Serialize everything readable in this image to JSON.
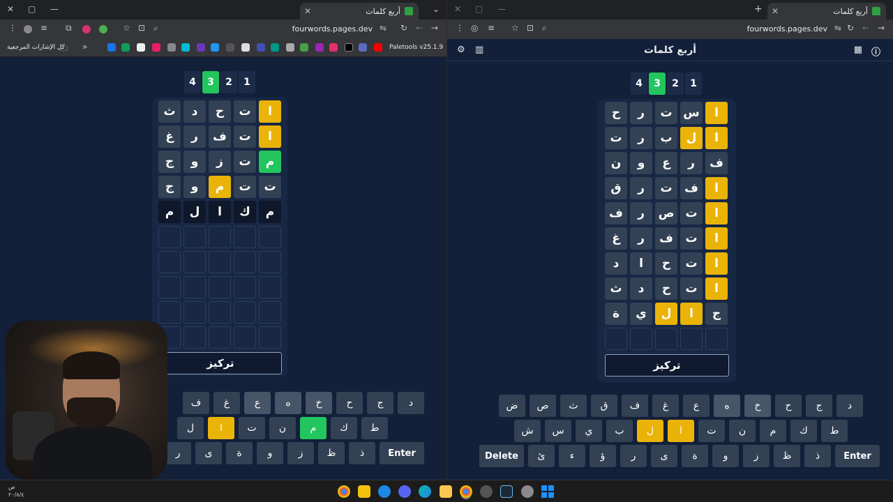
{
  "browser": {
    "tab_title": "أربع كلمات",
    "url": "fourwords.pages.dev",
    "bookmarks_label": "كل الإشارات المرجعية",
    "bookmark_ext": "Paletools v25.1.9",
    "minimize": "—",
    "maximize": "▢",
    "close": "✕",
    "new_tab": "+",
    "tab_close": "✕",
    "dropdown": "⌄",
    "bookmark_chev": "»"
  },
  "app": {
    "title": "أربع كلمات",
    "focus_label": "تركيز",
    "enter_label": "Enter",
    "delete_label": "Delete",
    "tabs": [
      "4",
      "3",
      "2",
      "1"
    ],
    "active_tab": "3"
  },
  "left_board": {
    "rows": [
      [
        "ا",
        "ت",
        "ح",
        "د",
        "ث"
      ],
      [
        "ا",
        "ت",
        "ف",
        "ر",
        "غ"
      ],
      [
        "م",
        "ت",
        "ز",
        "و",
        "ج"
      ],
      [
        "ت",
        "ت",
        "م",
        "و",
        "ج"
      ],
      [
        "م",
        "ك",
        "ا",
        "ل",
        "م"
      ]
    ]
  },
  "right_board": {
    "rows": [
      [
        "ا",
        "س",
        "ت",
        "ر",
        "ح"
      ],
      [
        "ا",
        "ل",
        "ب",
        "ر",
        "ت"
      ],
      [
        "ف",
        "ر",
        "ع",
        "و",
        "ن"
      ],
      [
        "ا",
        "ف",
        "ت",
        "ر",
        "ق"
      ],
      [
        "ا",
        "ت",
        "ص",
        "ر",
        "ف"
      ],
      [
        "ا",
        "ت",
        "ف",
        "ر",
        "غ"
      ],
      [
        "ا",
        "ت",
        "ح",
        "ا",
        "د"
      ],
      [
        "ا",
        "ت",
        "ح",
        "د",
        "ث"
      ],
      [
        "ج",
        "ا",
        "ل",
        "ي",
        "ة"
      ]
    ]
  },
  "keyboard": {
    "row1": [
      "د",
      "ج",
      "ح",
      "خ",
      "ه",
      "ع",
      "غ",
      "ف",
      "ق",
      "ث",
      "ص",
      "ض"
    ],
    "row2": [
      "ط",
      "ك",
      "م",
      "ن",
      "ت",
      "ا",
      "ل",
      "ب",
      "ي",
      "س",
      "ش"
    ],
    "row3": [
      "ذ",
      "ظ",
      "ز",
      "و",
      "ة",
      "ى",
      "ر",
      "ؤ",
      "ء",
      "ئ"
    ],
    "left_row1": [
      "د",
      "ج",
      "ح",
      "خ",
      "ه",
      "ع",
      "غ",
      "ف"
    ],
    "left_row2": [
      "ط",
      "ك",
      "م",
      "ن",
      "ت",
      "ا",
      "ل"
    ],
    "left_row3": [
      "ذ",
      "ظ",
      "ز",
      "و",
      "ة",
      "ى",
      "ر"
    ]
  },
  "taskbar": {
    "clock_line1": "ص",
    "clock_line2": "٢٠/٨/٤"
  }
}
